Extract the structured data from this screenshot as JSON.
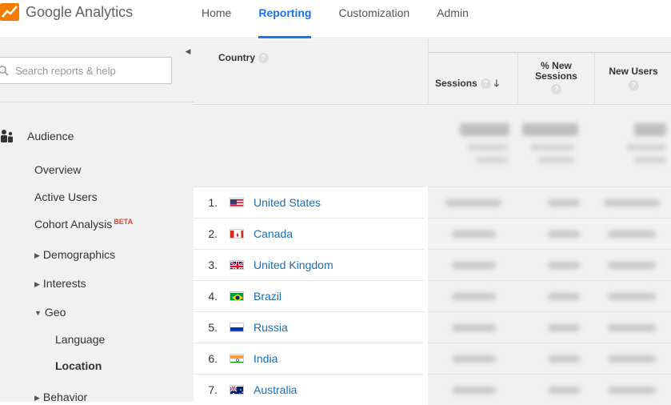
{
  "header": {
    "app_title": "Google Analytics",
    "nav": [
      "Home",
      "Reporting",
      "Customization",
      "Admin"
    ],
    "active_nav": "Reporting"
  },
  "sidebar": {
    "search_placeholder": "Search reports & help",
    "section_label": "Audience",
    "items": {
      "overview": "Overview",
      "active_users": "Active Users",
      "cohort": "Cohort Analysis",
      "beta": "BETA",
      "demographics": "Demographics",
      "interests": "Interests",
      "geo": "Geo",
      "language": "Language",
      "location": "Location",
      "behavior": "Behavior"
    }
  },
  "table": {
    "headers": {
      "country": "Country",
      "sessions": "Sessions",
      "pct_new_1": "% New",
      "pct_new_2": "Sessions",
      "new_users": "New Users",
      "help": "?"
    },
    "rows": [
      {
        "rank": "1.",
        "country": "United States",
        "flag": "us"
      },
      {
        "rank": "2.",
        "country": "Canada",
        "flag": "ca"
      },
      {
        "rank": "3.",
        "country": "United Kingdom",
        "flag": "gb"
      },
      {
        "rank": "4.",
        "country": "Brazil",
        "flag": "br"
      },
      {
        "rank": "5.",
        "country": "Russia",
        "flag": "ru"
      },
      {
        "rank": "6.",
        "country": "India",
        "flag": "in"
      },
      {
        "rank": "7.",
        "country": "Australia",
        "flag": "au"
      }
    ]
  },
  "colors": {
    "accent": "#1a73e8",
    "link": "#1a6fb5",
    "logo": "#f57c00",
    "beta": "#e8432b"
  }
}
